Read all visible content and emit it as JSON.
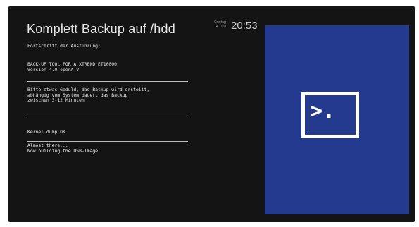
{
  "window": {
    "title": "Komplett Backup auf /hdd"
  },
  "clock": {
    "day": "Freitag",
    "date": "4. Juli",
    "time": "20:53"
  },
  "log": {
    "progress_heading": "Fortschritt der Ausführung:",
    "tool_line": "BACK-UP TOOL FOR A XTREND ET10000",
    "version_line": "Version 4.0 openATV",
    "wait_line1": "Bitte etwas Geduld, das Backup wird erstellt,",
    "wait_line2": "abhängig vom System dauert das Backup",
    "wait_line3": "zwischen 3-12 Minuten",
    "kernel_line": "Kernel dump OK",
    "almost_line": "Almost there...",
    "building_line": "Now building the USB-Image"
  },
  "panel": {
    "icon": "terminal-icon",
    "prompt_text": ">.",
    "background_color": "#233a8f"
  }
}
